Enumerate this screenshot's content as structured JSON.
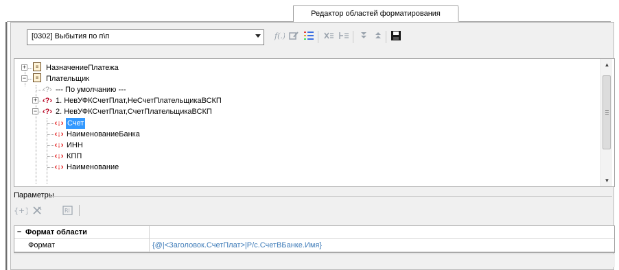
{
  "window": {
    "tab_title": "Редактор областей форматирования"
  },
  "toolbar": {
    "combo_value": "[0302] Выбытия по п\\п",
    "icons": [
      "function-icon",
      "edit-icon",
      "list-icon",
      "remove-icon",
      "remove-branch-icon",
      "move-down-icon",
      "move-up-icon",
      "save-icon"
    ]
  },
  "tree": {
    "nodes": [
      {
        "label": "НазначениеПлатежа"
      },
      {
        "label": "Плательщик"
      },
      {
        "label": "--- По умолчанию ---"
      },
      {
        "label": "1. НевУФКСчетПлат,НеСчетПлательщикаВСКП"
      },
      {
        "label": "2. НевУФКСчетПлат,СчетПлательщикаВСКП"
      },
      {
        "label": "Счет"
      },
      {
        "label": "НаименованиеБанка"
      },
      {
        "label": "ИНН"
      },
      {
        "label": "КПП"
      },
      {
        "label": "Наименование"
      }
    ]
  },
  "params": {
    "title": "Параметры"
  },
  "grid": {
    "section_title": "Формат области",
    "row_name": "Формат",
    "row_value": "{@|<Заголовок.СчетПлат>|Р/с.СчетВБанке.Имя}"
  },
  "colors": {
    "selection": "#3399ff",
    "format_value": "#3c7ab8",
    "accent_red": "#e00000"
  }
}
